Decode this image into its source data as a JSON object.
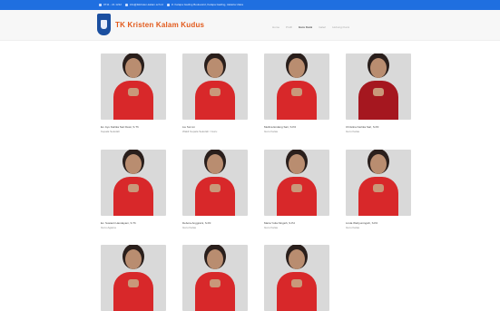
{
  "topbar": {
    "items": [
      {
        "icon": "phone-icon",
        "text": "0711 - 21 1212"
      },
      {
        "icon": "mail-icon",
        "text": "info@tkkristen-kalam.sch.id"
      },
      {
        "icon": "location-icon",
        "text": "Jl. Kelapa Gading Boulevard, Kelapa Gading, Jakarta Utara"
      }
    ]
  },
  "header": {
    "brand": "TK Kristen Kalam Kudus",
    "nav": [
      "Home",
      "Profil",
      "Guru Kami",
      "Galeri",
      "Hubungi Kami"
    ],
    "active_index": 2
  },
  "teachers": [
    {
      "name": "Ev. Ayu Kartika Sari Dewi, S.Th",
      "role": "Kepala Sekolah",
      "dark": false
    },
    {
      "name": "Lie Sui Lin",
      "role": "Wakil Kepala Sekolah / Guru",
      "dark": false
    },
    {
      "name": "Meilina Endang Sari, S.Pd",
      "role": "Guru Kelas",
      "dark": false
    },
    {
      "name": "Christina Kartika Sari, S.Pd",
      "role": "Guru Kelas",
      "dark": true
    },
    {
      "name": "Ev. Susianti Handayani, S.Th",
      "role": "Guru Agama",
      "dark": false
    },
    {
      "name": "Debora Anggraini, S.Pd",
      "role": "Guru Kelas",
      "dark": false
    },
    {
      "name": "Maria Yulia Ningsih, S.Pd",
      "role": "Guru Kelas",
      "dark": false
    },
    {
      "name": "Linda Wahyuningsih, S.Pd",
      "role": "Guru Kelas",
      "dark": false
    },
    {
      "name": "",
      "role": "",
      "dark": false
    },
    {
      "name": "",
      "role": "",
      "dark": false
    },
    {
      "name": "",
      "role": "",
      "dark": false
    }
  ]
}
